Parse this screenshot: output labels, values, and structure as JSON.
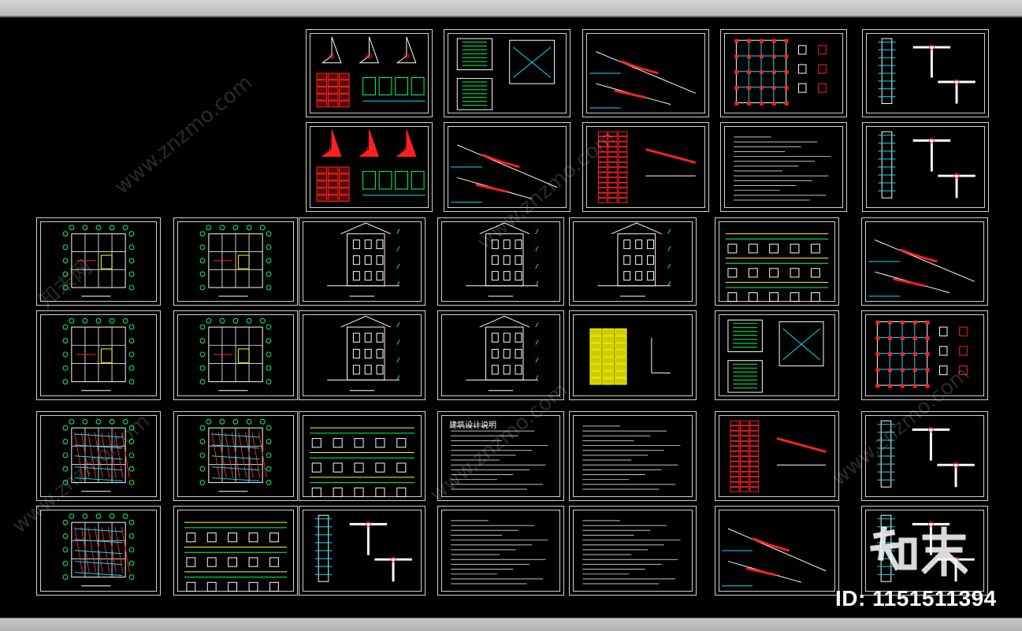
{
  "sheets": [
    {
      "id": "s-1-1",
      "kind": "details-tables",
      "col": 0,
      "row": 0
    },
    {
      "id": "s-1-2",
      "kind": "stair-plan",
      "col": 1,
      "row": 0
    },
    {
      "id": "s-1-3",
      "kind": "stair-section",
      "col": 2,
      "row": 0
    },
    {
      "id": "s-1-4",
      "kind": "framing-plan",
      "col": 3,
      "row": 0
    },
    {
      "id": "s-1-5",
      "kind": "column-detail",
      "col": 4,
      "row": 0
    },
    {
      "id": "s-2-1",
      "kind": "red-details",
      "col": 0,
      "row": 1
    },
    {
      "id": "s-2-2",
      "kind": "stair-section",
      "col": 1,
      "row": 1
    },
    {
      "id": "s-2-3",
      "kind": "table-stair",
      "col": 2,
      "row": 1
    },
    {
      "id": "s-2-4",
      "kind": "text-notes",
      "col": 3,
      "row": 1
    },
    {
      "id": "s-2-5",
      "kind": "column-detail",
      "col": 4,
      "row": 1
    },
    {
      "id": "s-3-1",
      "kind": "floor-plan"
    },
    {
      "id": "s-3-2",
      "kind": "floor-plan"
    },
    {
      "id": "s-3-3",
      "kind": "elevation"
    },
    {
      "id": "s-3-4",
      "kind": "elevation"
    },
    {
      "id": "s-3-5",
      "kind": "elevation"
    },
    {
      "id": "s-3-6",
      "kind": "beam-details"
    },
    {
      "id": "s-3-7",
      "kind": "stair-section"
    },
    {
      "id": "s-4-1",
      "kind": "floor-plan"
    },
    {
      "id": "s-4-2",
      "kind": "roof-plan"
    },
    {
      "id": "s-4-3",
      "kind": "section"
    },
    {
      "id": "s-4-4",
      "kind": "elevation"
    },
    {
      "id": "s-4-5",
      "kind": "yellow-table"
    },
    {
      "id": "s-4-6",
      "kind": "stair-plan"
    },
    {
      "id": "s-4-7",
      "kind": "framing-plan"
    },
    {
      "id": "s-5-1",
      "kind": "rebar-plan"
    },
    {
      "id": "s-5-2",
      "kind": "rebar-plan"
    },
    {
      "id": "s-5-3",
      "kind": "beam-details"
    },
    {
      "id": "s-5-4",
      "kind": "text-notes"
    },
    {
      "id": "s-5-5",
      "kind": "text-notes"
    },
    {
      "id": "s-5-6",
      "kind": "table-stair"
    },
    {
      "id": "s-5-7",
      "kind": "column-detail"
    },
    {
      "id": "s-6-1",
      "kind": "rebar-plan"
    },
    {
      "id": "s-6-2",
      "kind": "beam-details"
    },
    {
      "id": "s-6-3",
      "kind": "column-detail"
    },
    {
      "id": "s-6-4",
      "kind": "text-notes"
    },
    {
      "id": "s-6-5",
      "kind": "text-notes"
    },
    {
      "id": "s-6-6",
      "kind": "stair-section"
    },
    {
      "id": "s-6-7",
      "kind": "column-detail"
    }
  ],
  "notes_title": "建筑设计说明",
  "watermark": {
    "text": "www.znzmo.com",
    "brand": "知末网"
  },
  "logo_text": "知末",
  "id_label": "ID: 1151511394",
  "colors": {
    "background": "#000000",
    "frame": "#cfcfcf",
    "red": "#ff2020",
    "green": "#00ff66",
    "cyan": "#00e5ff",
    "yellow": "#ffff00"
  }
}
